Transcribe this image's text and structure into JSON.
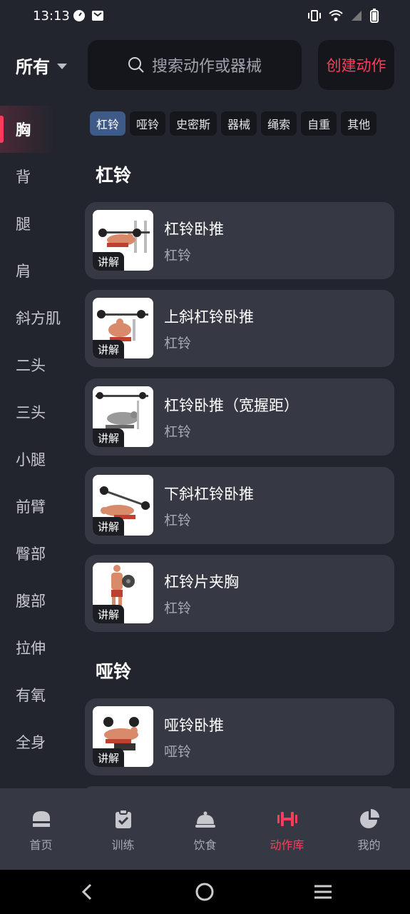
{
  "status": {
    "time": "13:13"
  },
  "header": {
    "filter_label": "所有",
    "search_placeholder": "搜索动作或器械",
    "create_label": "创建动作"
  },
  "sidebar": {
    "items": [
      "胸",
      "背",
      "腿",
      "肩",
      "斜方肌",
      "二头",
      "三头",
      "小腿",
      "前臂",
      "臀部",
      "腹部",
      "拉伸",
      "有氧",
      "全身"
    ],
    "active": "胸"
  },
  "chips": [
    "杠铃",
    "哑铃",
    "史密斯",
    "器械",
    "绳索",
    "自重",
    "其他"
  ],
  "sections": [
    {
      "title": "杠铃",
      "items": [
        {
          "name": "杠铃卧推",
          "category": "杠铃",
          "tag": "讲解"
        },
        {
          "name": "上斜杠铃卧推",
          "category": "杠铃",
          "tag": "讲解"
        },
        {
          "name": "杠铃卧推（宽握距）",
          "category": "杠铃",
          "tag": "讲解"
        },
        {
          "name": "下斜杠铃卧推",
          "category": "杠铃",
          "tag": "讲解"
        },
        {
          "name": "杠铃片夹胸",
          "category": "杠铃",
          "tag": "讲解"
        }
      ]
    },
    {
      "title": "哑铃",
      "items": [
        {
          "name": "哑铃卧推",
          "category": "哑铃",
          "tag": "讲解"
        }
      ]
    }
  ],
  "tabs": [
    {
      "label": "首页",
      "icon": "home-icon"
    },
    {
      "label": "训练",
      "icon": "clipboard-icon"
    },
    {
      "label": "饮食",
      "icon": "cloche-icon"
    },
    {
      "label": "动作库",
      "icon": "dumbbell-icon",
      "active": true
    },
    {
      "label": "我的",
      "icon": "pie-chart-icon"
    }
  ],
  "colors": {
    "accent": "#ff3c5c",
    "background": "#22252d",
    "card": "#363943",
    "chip_active": "#3d5a88"
  }
}
